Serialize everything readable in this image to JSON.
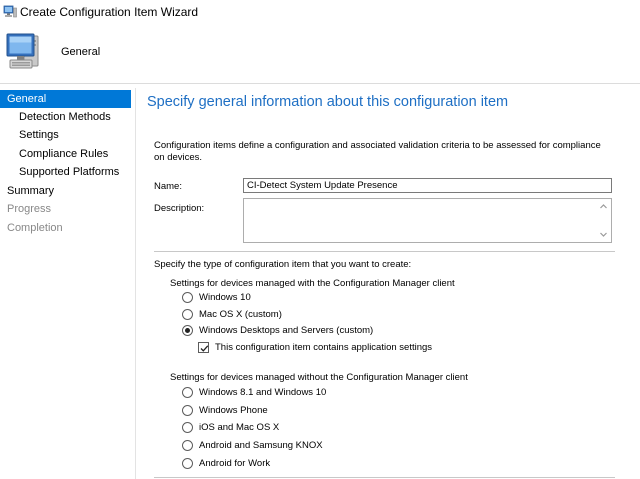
{
  "window": {
    "title": "Create Configuration Item Wizard"
  },
  "header": {
    "section_title": "General"
  },
  "sidebar": {
    "items": [
      {
        "label": "General",
        "state": "active",
        "level": "top"
      },
      {
        "label": "Detection Methods",
        "state": "normal",
        "level": "sub"
      },
      {
        "label": "Settings",
        "state": "normal",
        "level": "sub"
      },
      {
        "label": "Compliance Rules",
        "state": "normal",
        "level": "sub"
      },
      {
        "label": "Supported Platforms",
        "state": "normal",
        "level": "sub"
      },
      {
        "label": "Summary",
        "state": "normal",
        "level": "top"
      },
      {
        "label": "Progress",
        "state": "disabled",
        "level": "top"
      },
      {
        "label": "Completion",
        "state": "disabled",
        "level": "top"
      }
    ]
  },
  "main": {
    "heading": "Specify general information about this configuration item",
    "intro": "Configuration items define a configuration and associated validation criteria to be assessed for compliance on devices.",
    "name_label": "Name:",
    "name_value": "CI-Detect System Update Presence",
    "description_label": "Description:",
    "description_value": "",
    "type_prompt": "Specify the type of configuration item that you want to create:",
    "managed_group": {
      "label": "Settings for devices managed with the Configuration Manager client",
      "options": [
        {
          "label": "Windows 10",
          "checked": false
        },
        {
          "label": "Mac OS X (custom)",
          "checked": false
        },
        {
          "label": "Windows Desktops and Servers (custom)",
          "checked": true
        }
      ],
      "app_settings_checkbox": {
        "label": "This configuration item contains application settings",
        "checked": true
      }
    },
    "unmanaged_group": {
      "label": "Settings for devices managed without the Configuration Manager client",
      "options": [
        {
          "label": "Windows 8.1 and Windows 10",
          "checked": false
        },
        {
          "label": "Windows Phone",
          "checked": false
        },
        {
          "label": "iOS and Mac OS X",
          "checked": false
        },
        {
          "label": "Android and Samsung KNOX",
          "checked": false
        },
        {
          "label": "Android for Work",
          "checked": false
        }
      ]
    }
  },
  "colors": {
    "accent": "#0078d7",
    "heading": "#1e6fc4"
  }
}
